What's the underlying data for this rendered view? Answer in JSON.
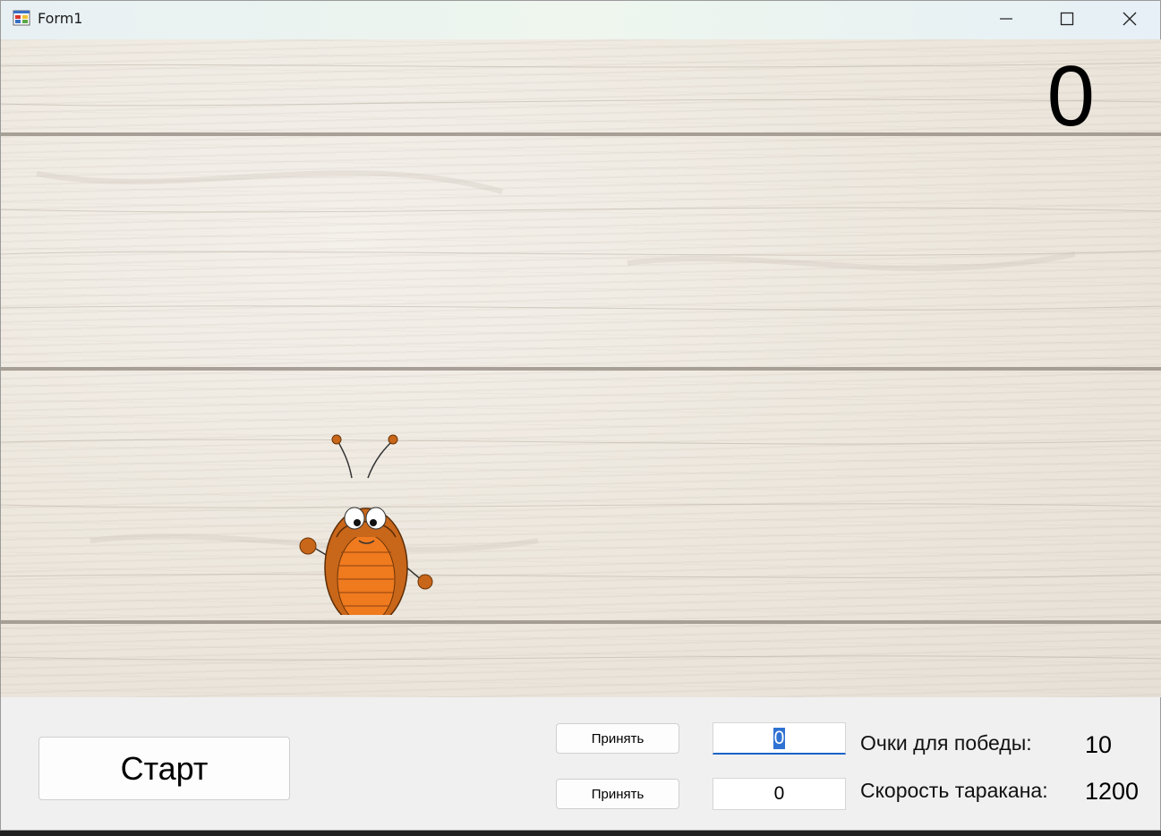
{
  "window": {
    "title": "Form1",
    "app_icon": "winforms-app-icon",
    "controls": [
      "minimize-icon",
      "maximize-icon",
      "close-icon"
    ]
  },
  "game": {
    "score": "0",
    "sprite": "cockroach-sprite",
    "background": "light-wood-planks"
  },
  "controls": {
    "start_label": "Старт",
    "accept1_label": "Принять",
    "accept2_label": "Принять",
    "points_input_value": "0",
    "speed_input_value": "0",
    "points_label": "Очки для победы:",
    "points_value": "10",
    "speed_label": "Скорость таракана:",
    "speed_value": "1200"
  },
  "colors": {
    "roach_body": "#c8661a",
    "roach_stripes": "#f07a1e",
    "focus_accent": "#1a62c8"
  }
}
